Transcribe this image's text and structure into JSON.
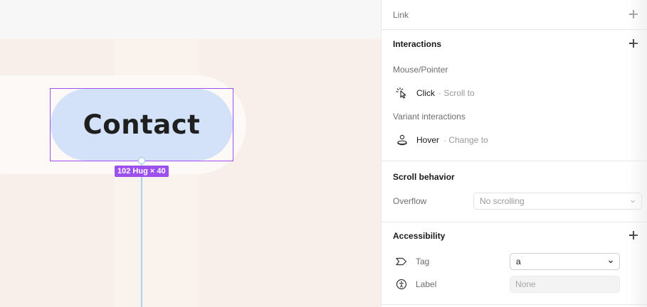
{
  "canvas": {
    "button_label": "Contact",
    "size_badge": "102 Hug × 40"
  },
  "panel": {
    "link": {
      "label": "Link",
      "add_icon": "plus-icon"
    },
    "interactions": {
      "heading": "Interactions",
      "mouse_section": "Mouse/Pointer",
      "click": {
        "trigger": "Click",
        "action": "· Scroll to",
        "icon": "cursor-click-icon"
      },
      "variant_section": "Variant interactions",
      "hover": {
        "trigger": "Hover",
        "action": "· Change to",
        "icon": "hover-icon"
      }
    },
    "scroll": {
      "heading": "Scroll behavior",
      "overflow_label": "Overflow",
      "overflow_value": "No scrolling"
    },
    "accessibility": {
      "heading": "Accessibility",
      "tag_label": "Tag",
      "tag_value": "a",
      "label_label": "Label",
      "label_placeholder": "None"
    }
  },
  "colors": {
    "selection": "#9d50ee",
    "button_fill": "#d3e2f9",
    "canvas_bg": "#f8efea",
    "connector": "#a9d3f4"
  }
}
